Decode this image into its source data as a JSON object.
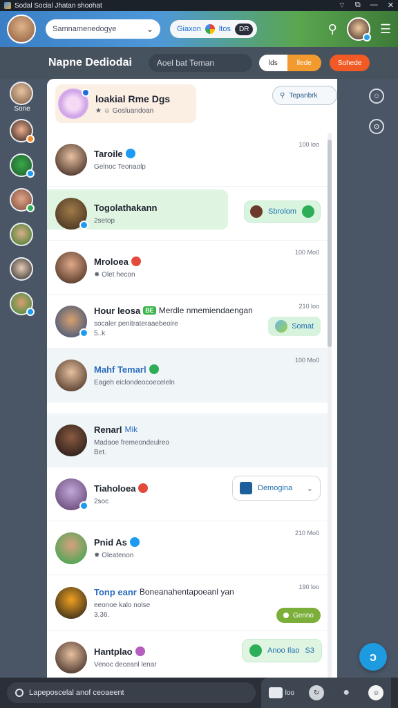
{
  "window": {
    "title": "Sodal Social Jhatan shoohat",
    "controls": [
      "wifi-icon",
      "pin-icon",
      "minimize-icon",
      "close-icon"
    ]
  },
  "header": {
    "search_value": "Samnamenedogye",
    "status_label": "Giaxon",
    "status_count": "ltos",
    "status_badge": "DR"
  },
  "subbar": {
    "title": "Napne Dediodai",
    "field_placeholder": "Aoel bat Teman",
    "segment_a": "lds",
    "segment_b": "llede",
    "action": "Sohede"
  },
  "rail": {
    "label": "Sone"
  },
  "group": {
    "title": "loakial Rme Dgs",
    "subtitle": "Gosluandoan",
    "team_button": "Tepanbrk"
  },
  "rows": [
    {
      "name": "Taroile",
      "sub": "Gelnoc Teonaolp",
      "time": "100 loo"
    },
    {
      "name": "Togolathakann",
      "sub": "2setop",
      "pill": "Sbrolom"
    },
    {
      "name": "Mroloea",
      "sub": "Olet hecon",
      "time": "100 Mo0"
    },
    {
      "name": "Hour leosa",
      "tag": "BE",
      "extra": "Merdle nmemiendaengan",
      "sub": "socaler penitrateraaebeoire",
      "sub2": "5..k",
      "time": "210 loo",
      "pill": "Somat"
    },
    {
      "name": "Mahf Temarl",
      "sub": "Eageh eiclondeocoeceleln",
      "time": "100 Mo0"
    },
    {
      "name": "Renarl",
      "extra": "Mik",
      "sub": "Madaoe fremeondeulreo",
      "sub2": "Bet."
    },
    {
      "name": "Tiaholoea",
      "sub": "2soc",
      "pill": "Demogina"
    },
    {
      "name": "Pnid As",
      "sub": "Oleatenon",
      "time": "210 Mo0"
    },
    {
      "name": "Tonp eanr",
      "extra": "Boneanahentapoeanl yan",
      "sub": "eeonoe kalo nolse",
      "sub2": "3.36.",
      "time": "190 loo",
      "pill": "Genno"
    },
    {
      "name": "Hantplao",
      "sub": "Venoc deceanl lenar",
      "pill": "Anoo Ilao",
      "pill_extra": "S3"
    }
  ],
  "bottom": {
    "input_placeholder": "Lapeposcelal anof ceoaeent",
    "icon_label": "loo"
  }
}
